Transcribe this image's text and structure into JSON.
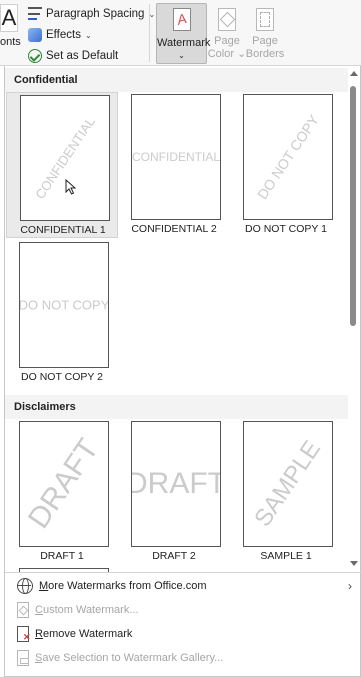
{
  "ribbon": {
    "font_letter": "A",
    "fonts_label": "onts",
    "paragraph_spacing_label": "Paragraph Spacing",
    "effects_label": "Effects",
    "set_default_label": "Set as Default",
    "watermark_label": "Watermark",
    "watermark_chevron": "⌄",
    "page_color_line1": "Page",
    "page_color_line2": "Color ⌄",
    "page_borders_line1": "Page",
    "page_borders_line2": "Borders"
  },
  "gallery": {
    "sections": [
      {
        "title": "Confidential",
        "items": [
          {
            "caption": "CONFIDENTIAL 1",
            "watermark_text": "CONFIDENTIAL",
            "style": "diagonal"
          },
          {
            "caption": "CONFIDENTIAL 2",
            "watermark_text": "CONFIDENTIAL",
            "style": "horizontal"
          },
          {
            "caption": "DO NOT COPY 1",
            "watermark_text": "DO NOT COPY",
            "style": "diagonal"
          },
          {
            "caption": "DO NOT COPY 2",
            "watermark_text": "DO NOT COPY",
            "style": "horizontal"
          }
        ]
      },
      {
        "title": "Disclaimers",
        "items": [
          {
            "caption": "DRAFT 1",
            "watermark_text": "DRAFT",
            "style": "diagonal"
          },
          {
            "caption": "DRAFT 2",
            "watermark_text": "DRAFT",
            "style": "horizontal"
          },
          {
            "caption": "SAMPLE 1",
            "watermark_text": "SAMPLE",
            "style": "diagonal"
          }
        ]
      }
    ]
  },
  "menu": {
    "more_watermarks": {
      "first": "M",
      "rest": "ore Watermarks from Office.com"
    },
    "custom_watermark": {
      "first": "C",
      "rest": "ustom Watermark..."
    },
    "remove_watermark": {
      "first": "R",
      "rest": "emove Watermark"
    },
    "save_selection": {
      "first": "S",
      "rest": "ave Selection to Watermark Gallery..."
    }
  },
  "colors": {
    "watermark_gray": "#cbcbcb",
    "hover_bg": "#eaeaea",
    "disabled_text": "#a6a6a6"
  }
}
